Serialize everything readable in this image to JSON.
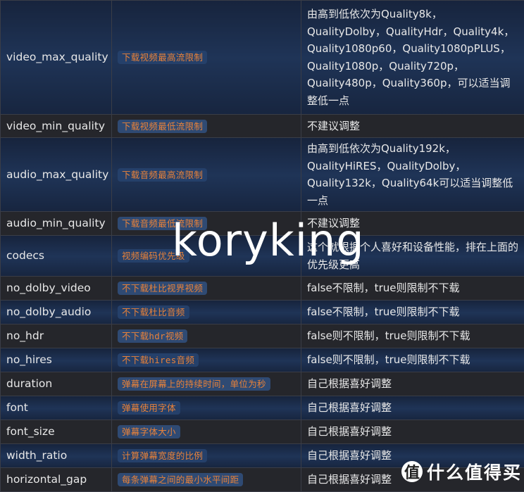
{
  "rows": [
    {
      "name": "video_max_quality",
      "tag": "下载视频最高流限制",
      "desc": "由高到低依次为Quality8k，QualityDolby，QualityHdr，Quality4k，Quality1080p60，Quality1080pPLUS，Quality1080p，Quality720p，Quality480p，Quality360p，可以适当调整低一点"
    },
    {
      "name": "video_min_quality",
      "tag": "下载视频最低流限制",
      "desc": "不建议调整"
    },
    {
      "name": "audio_max_quality",
      "tag": "下载音频最高流限制",
      "desc": "由高到低依次为Quality192k，QualityHiRES，QualityDolby，Quality132k，Quality64k可以适当调整低一点"
    },
    {
      "name": "audio_min_quality",
      "tag": "下载音频最低流限制",
      "desc": "不建议调整"
    },
    {
      "name": "codecs",
      "tag": "视频编码优先级",
      "desc": "这个就根据个人喜好和设备性能，排在上面的优先级更高"
    },
    {
      "name": "no_dolby_video",
      "tag": "不下载杜比视界视频",
      "desc": "false不限制，true则限制不下载"
    },
    {
      "name": "no_dolby_audio",
      "tag": "不下载杜比音频",
      "desc": "false不限制，true则限制不下载"
    },
    {
      "name": "no_hdr",
      "tag": "不下载hdr视频",
      "desc": "false则不限制，true则限制不下载"
    },
    {
      "name": "no_hires",
      "tag": "不下载hires音频",
      "desc": "false则不限制，true则限制不下载"
    },
    {
      "name": "duration",
      "tag": "弹幕在屏幕上的持续时间，单位为秒",
      "desc": "自己根据喜好调整"
    },
    {
      "name": "font",
      "tag": "弹幕使用字体",
      "desc": "自己根据喜好调整"
    },
    {
      "name": "font_size",
      "tag": "弹幕字体大小",
      "desc": "自己根据喜好调整"
    },
    {
      "name": "width_ratio",
      "tag": "计算弹幕宽度的比例",
      "desc": "自己根据喜好调整"
    },
    {
      "name": "horizontal_gap",
      "tag": "每条弹幕之间的最小水平间距",
      "desc": "自己根据喜好调整"
    }
  ],
  "watermark": "koryking",
  "logo": {
    "mark": "值",
    "text": "什么值得买"
  }
}
